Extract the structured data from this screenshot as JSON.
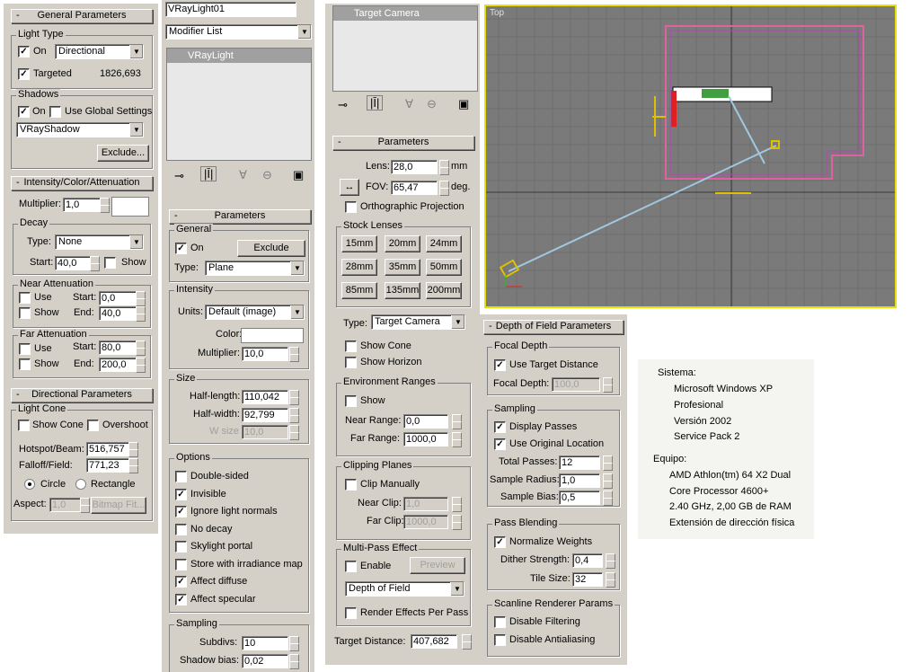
{
  "general": {
    "title": "General Parameters",
    "light_type": "Light Type",
    "on": "On",
    "type_value": "Directional",
    "targeted": "Targeted",
    "target_dist": "1826,693",
    "shadows": "Shadows",
    "shadows_on": "On",
    "use_global": "Use Global Settings",
    "shadow_type": "VRayShadow",
    "exclude": "Exclude..."
  },
  "ica": {
    "title": "Intensity/Color/Attenuation",
    "multiplier": "Multiplier:",
    "mult_value": "1,0",
    "decay": "Decay",
    "type": "Type:",
    "type_value": "None",
    "start": "Start:",
    "start_value": "40,0",
    "show": "Show",
    "near": "Near Attenuation",
    "use": "Use",
    "near_start": "0,0",
    "near_end": "40,0",
    "end": "End:",
    "far": "Far Attenuation",
    "far_start": "80,0",
    "far_end": "200,0"
  },
  "dir": {
    "title": "Directional Parameters",
    "light_cone": "Light Cone",
    "show_cone": "Show Cone",
    "overshoot": "Overshoot",
    "hotspot": "Hotspot/Beam:",
    "hotspot_value": "516,757",
    "falloff": "Falloff/Field:",
    "falloff_value": "771,23",
    "circle": "Circle",
    "rectangle": "Rectangle",
    "aspect": "Aspect:",
    "aspect_value": "1,0",
    "bitmap_fit": "Bitmap Fit..."
  },
  "vray": {
    "name": "VRayLight01",
    "modifier_list": "Modifier List",
    "stack_item": "VRayLight",
    "params": "Parameters",
    "general": "General",
    "on": "On",
    "exclude": "Exclude",
    "type": "Type:",
    "type_value": "Plane",
    "intensity": "Intensity",
    "units": "Units:",
    "units_value": "Default (image)",
    "color": "Color:",
    "multiplier": "Multiplier:",
    "mult_value": "10,0",
    "size": "Size",
    "half_length": "Half-length:",
    "hl_value": "110,042",
    "half_width": "Half-width:",
    "hw_value": "92,799",
    "wsize": "W size",
    "ws_value": "10,0",
    "options": "Options",
    "double_sided": "Double-sided",
    "invisible": "Invisible",
    "ignore_normals": "Ignore light normals",
    "no_decay": "No decay",
    "skylight": "Skylight portal",
    "store_irr": "Store with irradiance map",
    "affect_diffuse": "Affect diffuse",
    "affect_specular": "Affect specular",
    "sampling": "Sampling",
    "subdivs": "Subdivs:",
    "subdivs_value": "10",
    "shadow_bias": "Shadow bias:",
    "bias_value": "0,02"
  },
  "cam": {
    "stack_item": "Target Camera",
    "params": "Parameters",
    "lens": "Lens:",
    "lens_value": "28,0",
    "mm": "mm",
    "fov": "FOV:",
    "fov_value": "65,47",
    "deg": "deg.",
    "ortho": "Orthographic Projection",
    "stock": "Stock Lenses",
    "lenses": [
      "15mm",
      "20mm",
      "24mm",
      "28mm",
      "35mm",
      "50mm",
      "85mm",
      "135mm",
      "200mm"
    ],
    "type": "Type:",
    "type_value": "Target Camera",
    "show_cone": "Show Cone",
    "show_horizon": "Show Horizon",
    "env": "Environment Ranges",
    "show": "Show",
    "near_range": "Near Range:",
    "near_value": "0,0",
    "far_range": "Far Range:",
    "far_value": "1000,0",
    "clip": "Clipping Planes",
    "clip_manually": "Clip Manually",
    "near_clip": "Near Clip:",
    "near_clip_value": "1,0",
    "far_clip": "Far Clip:",
    "far_clip_value": "1000,0",
    "multipass": "Multi-Pass Effect",
    "enable": "Enable",
    "preview": "Preview",
    "effect_value": "Depth of Field",
    "render_effects": "Render Effects Per Pass",
    "target_dist": "Target Distance:",
    "target_dist_value": "407,682"
  },
  "dof": {
    "title": "Depth of Field Parameters",
    "focal": "Focal Depth",
    "use_target": "Use Target Distance",
    "focal_depth": "Focal Depth:",
    "focal_value": "100,0",
    "sampling": "Sampling",
    "display_passes": "Display Passes",
    "use_original": "Use Original Location",
    "total": "Total Passes:",
    "total_value": "12",
    "radius": "Sample Radius:",
    "radius_value": "1,0",
    "bias": "Sample Bias:",
    "bias_value": "0,5",
    "blending": "Pass Blending",
    "normalize": "Normalize Weights",
    "dither": "Dither Strength:",
    "dither_value": "0,4",
    "tile": "Tile Size:",
    "tile_value": "32",
    "scanline": "Scanline Renderer Params",
    "disable_filter": "Disable Filtering",
    "disable_aa": "Disable Antialiasing"
  },
  "viewport": {
    "label": "Top"
  },
  "sys": {
    "sistema": "Sistema:",
    "os": "Microsoft Windows XP",
    "ed": "Profesional",
    "ver": "Versión 2002",
    "sp": "Service Pack 2",
    "equipo": "Equipo:",
    "cpu1": "AMD Athlon(tm) 64 X2 Dual",
    "cpu2": "Core Processor 4600+",
    "cpu3": "2.40 GHz, 2,00 GB de RAM",
    "pae": "Extensión de dirección física"
  }
}
